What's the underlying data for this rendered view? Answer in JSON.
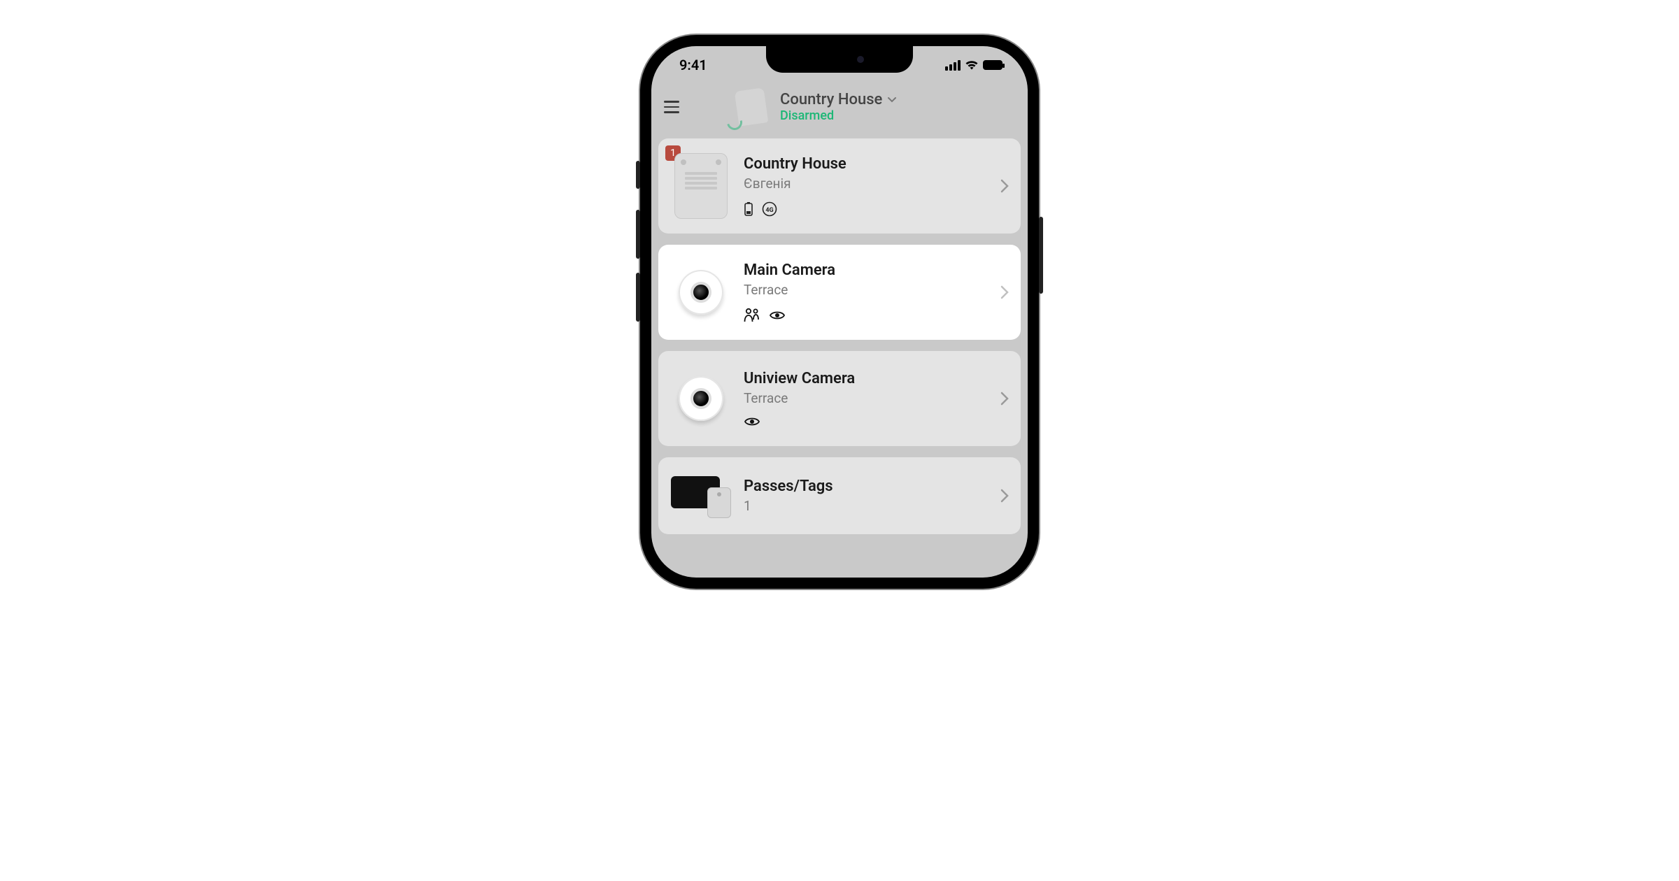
{
  "status_bar": {
    "time": "9:41"
  },
  "header": {
    "title": "Country House",
    "status": "Disarmed"
  },
  "devices": [
    {
      "title": "Country House",
      "subtitle": "Євгенія",
      "badge": "1",
      "type": "hub",
      "icons": [
        "battery",
        "4g"
      ],
      "highlight": false
    },
    {
      "title": "Main Camera",
      "subtitle": "Terrace",
      "type": "camera",
      "icons": [
        "person",
        "eye"
      ],
      "highlight": true
    },
    {
      "title": "Uniview Camera",
      "subtitle": "Terrace",
      "type": "camera",
      "icons": [
        "eye"
      ],
      "highlight": false
    },
    {
      "title": "Passes/Tags",
      "subtitle": "1",
      "type": "passes",
      "icons": [],
      "highlight": false
    }
  ]
}
